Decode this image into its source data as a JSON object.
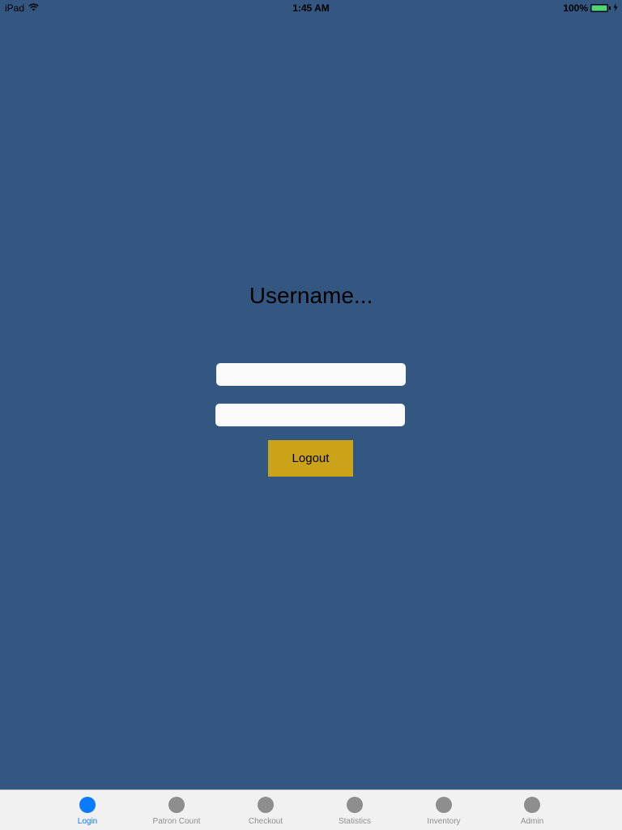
{
  "status_bar": {
    "device": "iPad",
    "time": "1:45 AM",
    "battery": "100%",
    "battery_level": 1.0,
    "icons": [
      "wifi-icon",
      "battery-icon",
      "charging-icon"
    ]
  },
  "main": {
    "heading": "Username...",
    "username_field": {
      "value": "",
      "placeholder": ""
    },
    "password_field": {
      "value": "",
      "placeholder": ""
    },
    "logout_label": "Logout"
  },
  "tab_bar": {
    "active_color": "#0a7aff",
    "inactive_color": "#8e8e8e",
    "tabs": [
      {
        "label": "Login",
        "active": true
      },
      {
        "label": "Patron Count",
        "active": false
      },
      {
        "label": "Checkout",
        "active": false
      },
      {
        "label": "Statistics",
        "active": false
      },
      {
        "label": "Inventory",
        "active": false
      },
      {
        "label": "Admin",
        "active": false
      }
    ]
  },
  "colors": {
    "background": "#345782",
    "button": "#caa31a",
    "field": "#fafafa"
  }
}
